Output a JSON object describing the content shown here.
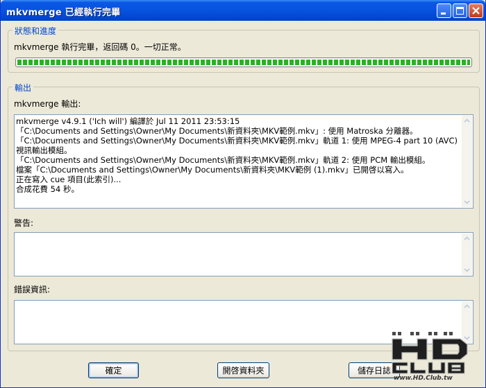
{
  "window": {
    "title": "mkvmerge 已經執行完畢"
  },
  "status_group": {
    "legend": "狀態和進度",
    "status_text": "mkvmerge 執行完畢，返回碼 0。一切正常。",
    "progress": 1.0
  },
  "output_group": {
    "legend": "輸出",
    "output_label": "mkvmerge 輸出:",
    "output_log": "mkvmerge v4.9.1 ('Ich will') 編譯於 Jul 11 2011 23:53:15\n「C:\\Documents and Settings\\Owner\\My Documents\\新資料夾\\MKV範例.mkv」: 使用 Matroska 分離器。\n「C:\\Documents and Settings\\Owner\\My Documents\\新資料夾\\MKV範例.mkv」軌道 1: 使用 MPEG-4 part 10 (AVC)\n視訊輸出模組。\n「C:\\Documents and Settings\\Owner\\My Documents\\新資料夾\\MKV範例.mkv」軌道 2: 使用 PCM 輸出模組。\n檔案「C:\\Documents and Settings\\Owner\\My Documents\\新資料夾\\MKV範例 (1).mkv」已開啓以寫入。\n正在寫入 cue 項目(此索引)...\n合成花費 54 秒。",
    "warnings_label": "警告:",
    "warnings_log": "",
    "errors_label": "錯誤資訊:",
    "errors_log": ""
  },
  "buttons": {
    "ok": "確定",
    "open_folder": "開啓資料夾",
    "save_log": "儲存日誌"
  },
  "watermark": {
    "url": "www.HD.Club.tw"
  },
  "colors": {
    "accent": "#0046d5",
    "progress": "#26b51f",
    "titlebar": "#0653e0"
  }
}
